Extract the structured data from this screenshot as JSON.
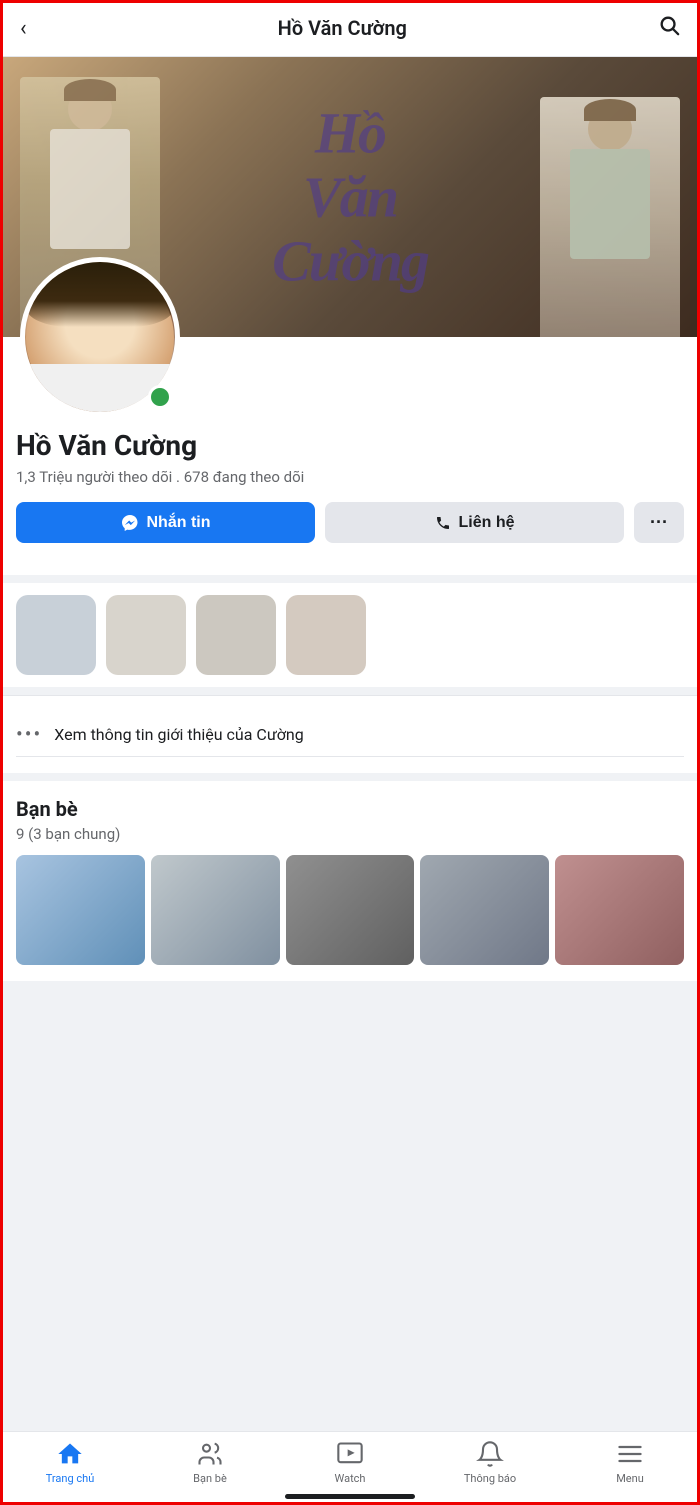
{
  "header": {
    "back_label": "‹",
    "title": "Hồ Văn Cường",
    "search_icon": "🔍"
  },
  "profile": {
    "name": "Hồ Văn Cường",
    "followers_text": "1,3 Triệu người theo dõi . 678 đang theo dõi",
    "online": true
  },
  "buttons": {
    "message_label": "Nhắn tin",
    "contact_label": "Liên hệ",
    "more_label": "···"
  },
  "info": {
    "bio_link_text": "Xem thông tin giới thiệu của Cường"
  },
  "friends": {
    "header": "Bạn bè",
    "count_text": "9 (3 bạn chung)"
  },
  "cover": {
    "text_art": "Hồ\nVăn\nCường"
  },
  "bottom_nav": {
    "items": [
      {
        "id": "home",
        "label": "Trang chủ",
        "active": true
      },
      {
        "id": "friends",
        "label": "Bạn bè",
        "active": false
      },
      {
        "id": "watch",
        "label": "Watch",
        "active": false
      },
      {
        "id": "notifications",
        "label": "Thông báo",
        "active": false
      },
      {
        "id": "menu",
        "label": "Menu",
        "active": false
      }
    ]
  }
}
